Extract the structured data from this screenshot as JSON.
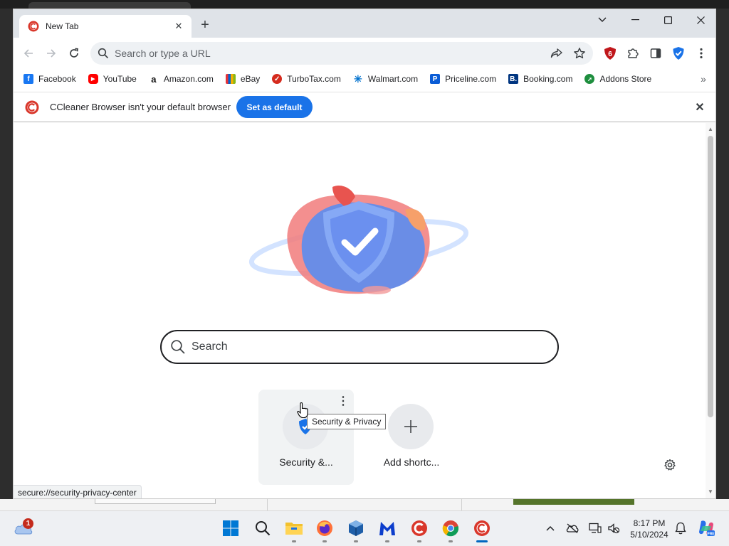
{
  "browser": {
    "tab": {
      "title": "New Tab"
    },
    "omnibox": {
      "placeholder": "Search or type a URL"
    },
    "extension_badge": "6",
    "bookmarks": [
      {
        "label": "Facebook",
        "icon": "facebook-icon",
        "color": "#1877f2"
      },
      {
        "label": "YouTube",
        "icon": "youtube-icon",
        "color": "#ff0000"
      },
      {
        "label": "Amazon.com",
        "icon": "amazon-icon",
        "color": "#111111"
      },
      {
        "label": "eBay",
        "icon": "ebay-icon",
        "color": "#e53238"
      },
      {
        "label": "TurboTax.com",
        "icon": "turbotax-icon",
        "color": "#d52b1e"
      },
      {
        "label": "Walmart.com",
        "icon": "walmart-icon",
        "color": "#0071ce"
      },
      {
        "label": "Priceline.com",
        "icon": "priceline-icon",
        "color": "#0a5cd6"
      },
      {
        "label": "Booking.com",
        "icon": "booking-icon",
        "color": "#003580"
      },
      {
        "label": "Addons Store",
        "icon": "addons-store-icon",
        "color": "#1e8e3e"
      }
    ],
    "infobar": {
      "message": "CCleaner Browser isn't your default browser",
      "button": "Set as default"
    }
  },
  "ntp": {
    "search_placeholder": "Search",
    "tiles": [
      {
        "label": "Security &...",
        "tooltip": "Security & Privacy"
      },
      {
        "label": "Add shortc..."
      }
    ],
    "status_url": "secure://security-privacy-center"
  },
  "taskbar": {
    "notification_count": "1",
    "clock_time": "8:17 PM",
    "clock_date": "5/10/2024",
    "apps": [
      "start-icon",
      "search-icon",
      "file-explorer-icon",
      "firefox-icon",
      "virtualbox-icon",
      "malwarebytes-icon",
      "ccleaner-icon",
      "chrome-icon",
      "ccleaner-browser-icon"
    ]
  },
  "colors": {
    "accent": "#1a73e8",
    "tabstrip": "#dfe3e8"
  }
}
